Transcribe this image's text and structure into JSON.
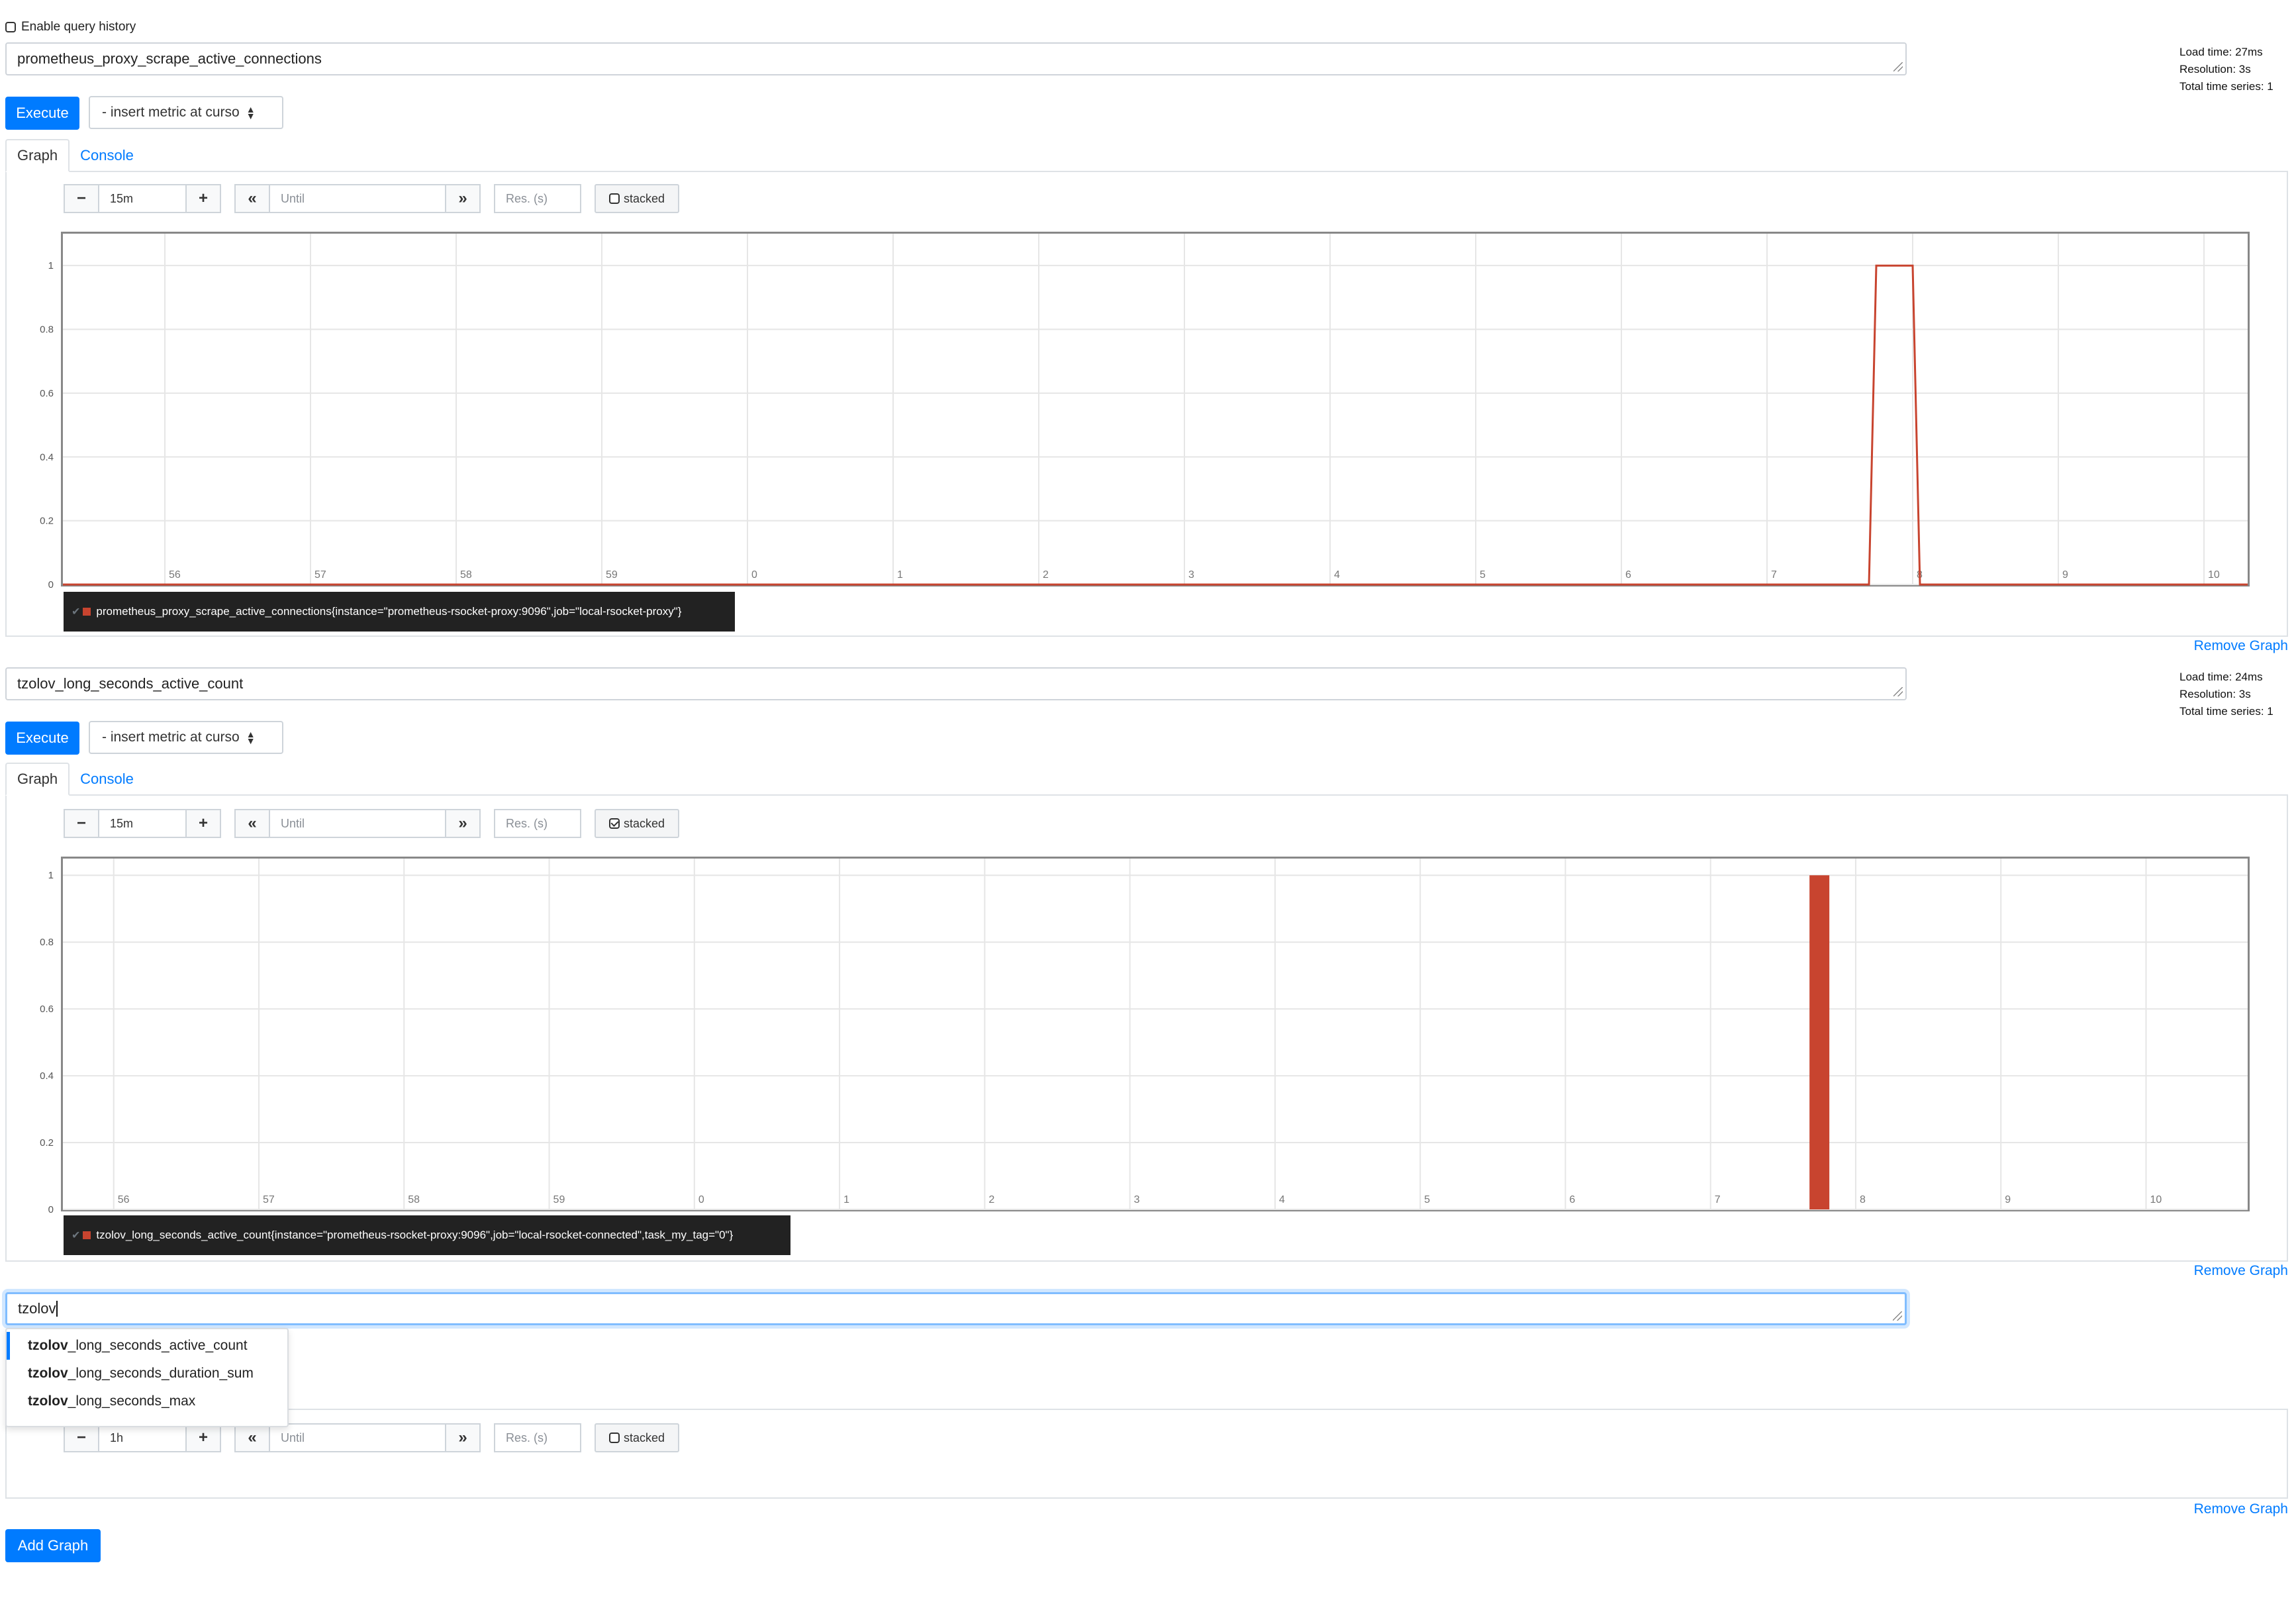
{
  "query_history": {
    "label": "Enable query history",
    "checked": false
  },
  "graphs": [
    {
      "expression": "prometheus_proxy_scrape_active_connections",
      "stats": [
        "Load time: 27ms",
        "Resolution: 3s",
        "Total time series: 1"
      ],
      "execute_label": "Execute",
      "insert_metric": "- insert metric at curso",
      "tabs": [
        "Graph",
        "Console"
      ],
      "active_tab": "Graph",
      "range": "15m",
      "until_placeholder": "Until",
      "res_placeholder": "Res. (s)",
      "stacked_label": "stacked",
      "stacked": false,
      "legend": "prometheus_proxy_scrape_active_connections{instance=\"prometheus-rsocket-proxy:9096\",job=\"local-rsocket-proxy\"}",
      "remove_label": "Remove Graph"
    },
    {
      "expression": "tzolov_long_seconds_active_count",
      "stats": [
        "Load time: 24ms",
        "Resolution: 3s",
        "Total time series: 1"
      ],
      "execute_label": "Execute",
      "insert_metric": "- insert metric at curso",
      "tabs": [
        "Graph",
        "Console"
      ],
      "active_tab": "Graph",
      "range": "15m",
      "until_placeholder": "Until",
      "res_placeholder": "Res. (s)",
      "stacked_label": "stacked",
      "stacked": true,
      "legend": "tzolov_long_seconds_active_count{instance=\"prometheus-rsocket-proxy:9096\",job=\"local-rsocket-connected\",task_my_tag=\"0\"}",
      "remove_label": "Remove Graph"
    },
    {
      "expression": "tzolov",
      "autocomplete": [
        {
          "match": "tzolov",
          "rest": "_long_seconds_active_count"
        },
        {
          "match": "tzolov",
          "rest": "_long_seconds_duration_sum"
        },
        {
          "match": "tzolov",
          "rest": "_long_seconds_max"
        }
      ],
      "range": "1h",
      "until_placeholder": "Until",
      "res_placeholder": "Res. (s)",
      "stacked_label": "stacked",
      "stacked": false,
      "remove_label": "Remove Graph"
    }
  ],
  "add_graph_label": "Add Graph",
  "icons": {
    "minus": "−",
    "plus": "+",
    "back": "«",
    "forward": "»"
  },
  "colors": {
    "primary": "#007bff",
    "series": "#c8442f",
    "legend_bg": "#222222"
  },
  "chart_data": [
    {
      "type": "line",
      "title": "",
      "x_tick_labels": [
        "56",
        "57",
        "58",
        "59",
        "0",
        "1",
        "2",
        "3",
        "4",
        "5",
        "6",
        "7",
        "8",
        "9",
        "10"
      ],
      "yticks": [
        0,
        0.2,
        0.4,
        0.6,
        0.8,
        1
      ],
      "ylim": [
        0,
        1.1
      ],
      "xlim": [
        55.3,
        70.3
      ],
      "grid": true,
      "legend_position": "bottom",
      "series": [
        {
          "name": "prometheus_proxy_scrape_active_connections{instance=\"prometheus-rsocket-proxy:9096\",job=\"local-rsocket-proxy\"}",
          "x": [
            55.3,
            67.7,
            67.75,
            68.0,
            68.05,
            70.3
          ],
          "y": [
            0,
            0,
            1,
            1,
            0,
            0
          ]
        }
      ]
    },
    {
      "type": "bar",
      "title": "",
      "x_tick_labels": [
        "56",
        "57",
        "58",
        "59",
        "0",
        "1",
        "2",
        "3",
        "4",
        "5",
        "6",
        "7",
        "8",
        "9",
        "10"
      ],
      "yticks": [
        0,
        0.2,
        0.4,
        0.6,
        0.8,
        1
      ],
      "ylim": [
        0,
        1.05
      ],
      "xlim": [
        55.65,
        70.7
      ],
      "grid": true,
      "stacked": true,
      "legend_position": "bottom",
      "series": [
        {
          "name": "tzolov_long_seconds_active_count{instance=\"prometheus-rsocket-proxy:9096\",job=\"local-rsocket-connected\",task_my_tag=\"0\"}",
          "x": [
            67.75
          ],
          "y": [
            1
          ]
        }
      ]
    }
  ]
}
